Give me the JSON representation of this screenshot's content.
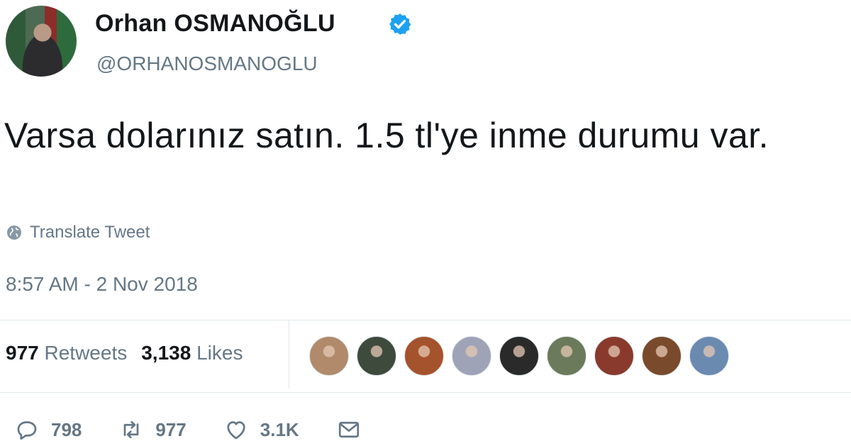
{
  "author": {
    "name": "Orhan OSMANOĞLU",
    "handle": "@ORHANOSMANOGLU",
    "verified": true,
    "verified_color": "#1da1f2"
  },
  "tweet": {
    "text": "Varsa dolarınız satın. 1.5 tl'ye inme durumu var.",
    "translate_label": "Translate Tweet",
    "timestamp": "8:57 AM - 2 Nov 2018"
  },
  "stats": {
    "retweets_count": "977",
    "retweets_label": "Retweets",
    "likes_count": "3,138",
    "likes_label": "Likes"
  },
  "liker_avatars": [
    "#b08a6a",
    "#3e4a3c",
    "#a5532c",
    "#9fa3b8",
    "#2a2a2a",
    "#6b7a5a",
    "#8a3a2c",
    "#7a4a2c",
    "#6a8ab0"
  ],
  "actions": {
    "reply_count": "798",
    "retweet_count": "977",
    "like_count": "3.1K",
    "reply_icon": "reply-icon",
    "retweet_icon": "retweet-icon",
    "like_icon": "heart-icon",
    "message_icon": "envelope-icon"
  }
}
